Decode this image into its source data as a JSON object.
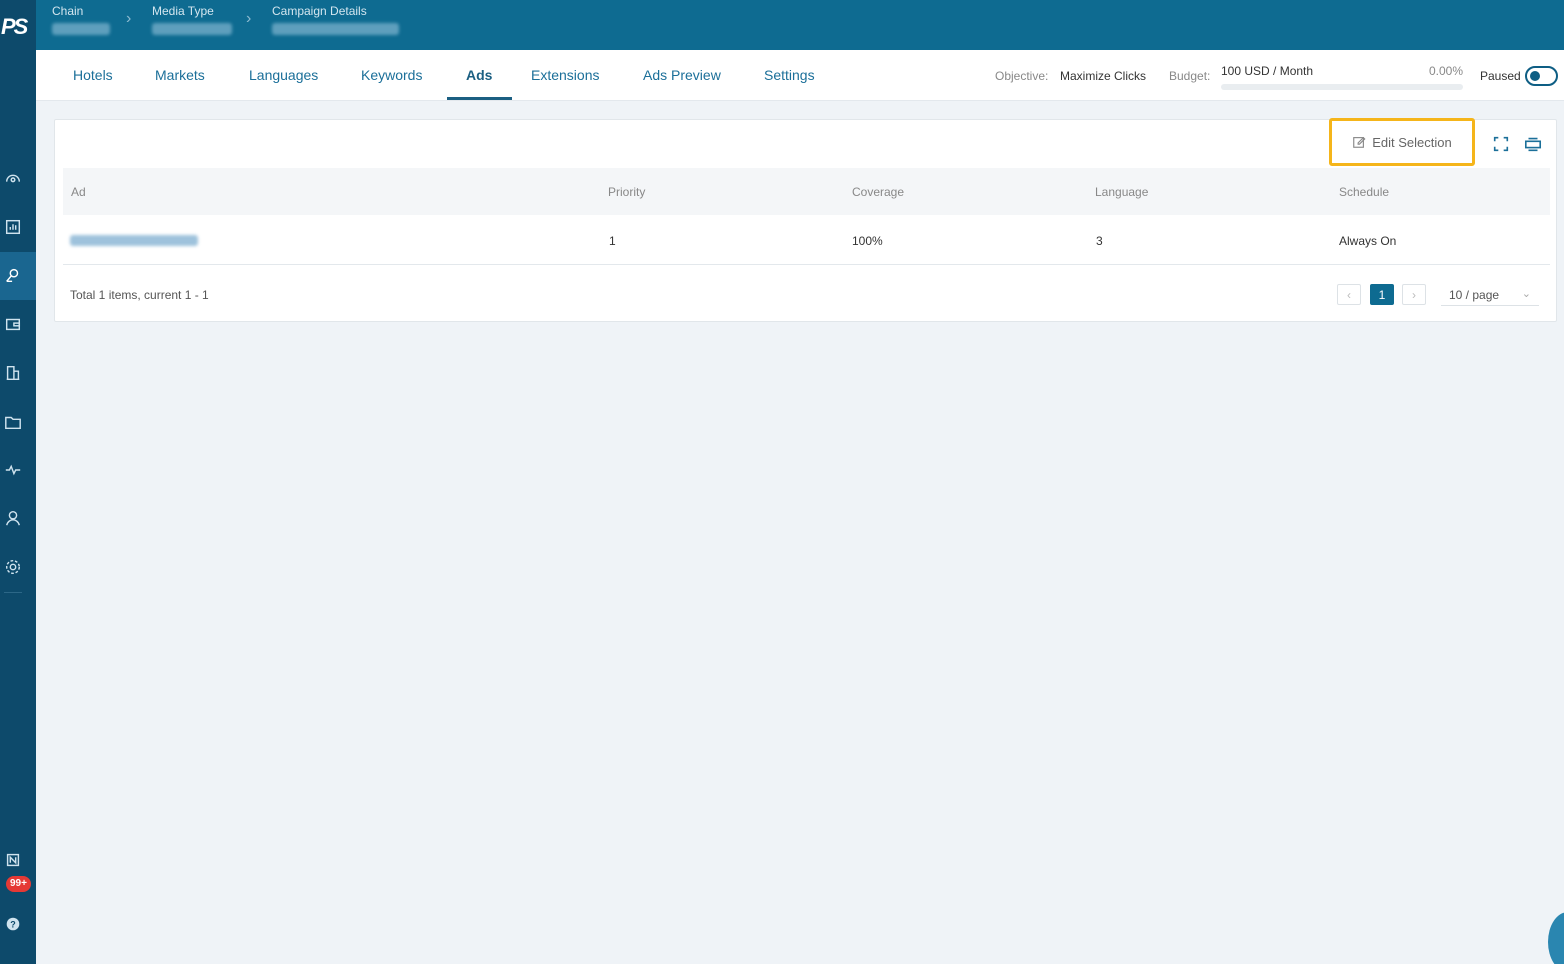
{
  "sidebar": {
    "logo": "PS",
    "notification_count": "99+"
  },
  "breadcrumb": {
    "chain_label": "Chain",
    "media_type_label": "Media Type",
    "campaign_details_label": "Campaign Details"
  },
  "tabs": [
    {
      "label": "Hotels"
    },
    {
      "label": "Markets"
    },
    {
      "label": "Languages"
    },
    {
      "label": "Keywords"
    },
    {
      "label": "Ads"
    },
    {
      "label": "Extensions"
    },
    {
      "label": "Ads Preview"
    },
    {
      "label": "Settings"
    }
  ],
  "campaign_meta": {
    "objective_label": "Objective:",
    "objective_value": "Maximize Clicks",
    "budget_label": "Budget:",
    "budget_value": "100 USD / Month",
    "budget_percent": "0.00%",
    "budget_fill_fraction": 0,
    "status_label": "Paused"
  },
  "toolbar": {
    "edit_selection_label": "Edit Selection"
  },
  "table": {
    "columns": [
      "Ad",
      "Priority",
      "Coverage",
      "Language",
      "Schedule"
    ],
    "rows": [
      {
        "priority": "1",
        "coverage": "100%",
        "language": "3",
        "schedule": "Always On"
      }
    ]
  },
  "pagination": {
    "summary": "Total 1 items, current 1 - 1",
    "current_page": "1",
    "page_size": "10 / page"
  },
  "colors": {
    "header": "#0e6b91",
    "sidebar": "#0d4a6b",
    "accent": "#1b5f82",
    "highlight": "#f5b51a"
  }
}
